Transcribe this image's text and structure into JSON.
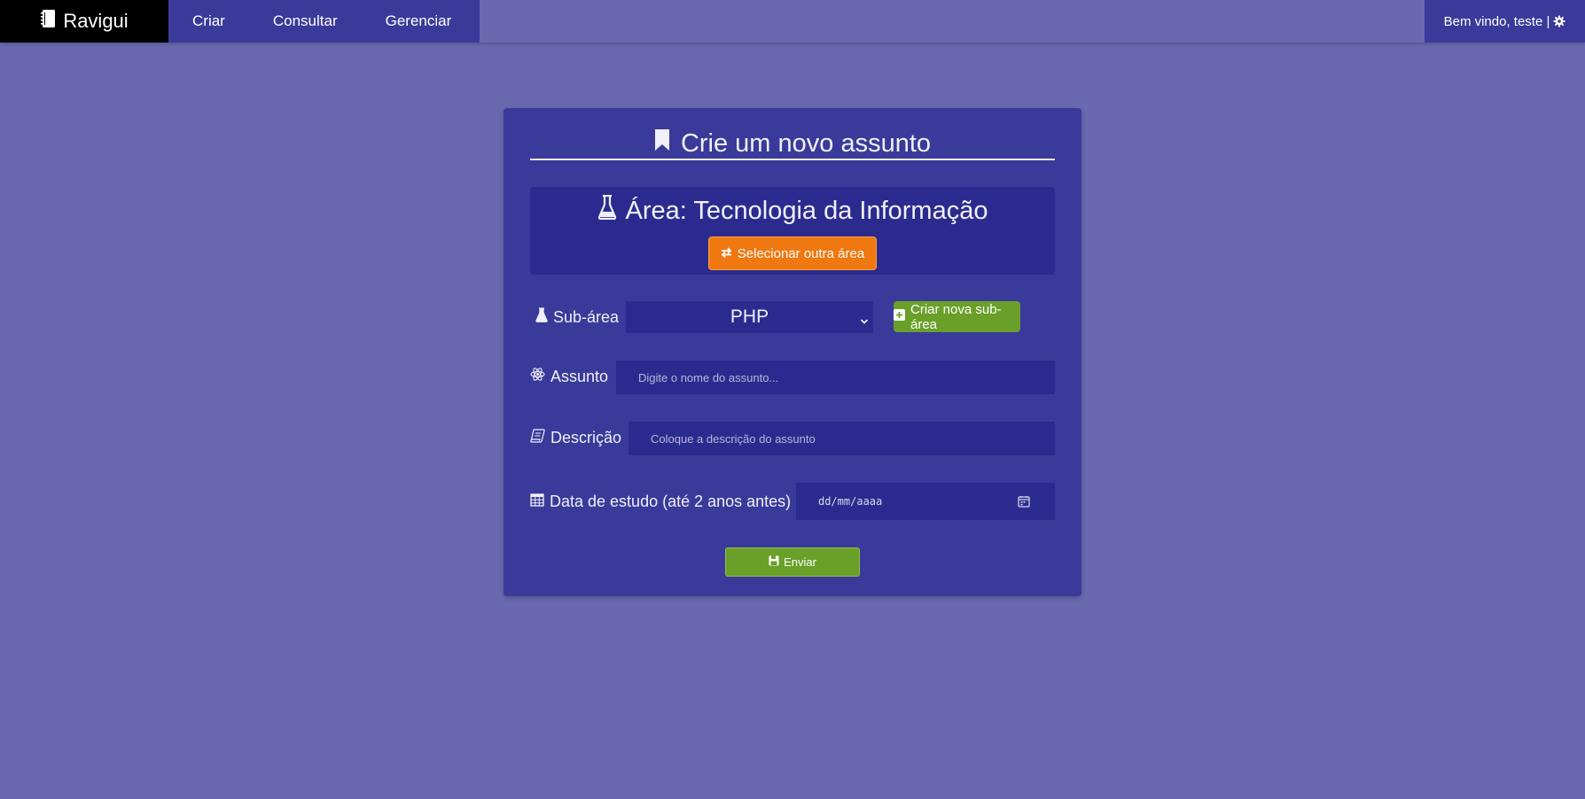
{
  "navbar": {
    "brand": "Ravigui",
    "links": [
      "Criar",
      "Consultar",
      "Gerenciar"
    ],
    "user_text": "Bem vindo, teste |"
  },
  "form": {
    "title": "Crie um novo assunto",
    "area": {
      "label": "Área: Tecnologia da Informação",
      "change_button": "Selecionar outra área"
    },
    "subarea": {
      "label": "Sub-área",
      "selected": "PHP",
      "new_button": "Criar nova sub-área"
    },
    "assunto": {
      "label": "Assunto",
      "placeholder": "Digite o nome do assunto..."
    },
    "descricao": {
      "label": "Descrição",
      "placeholder": "Coloque a descrição do assunto"
    },
    "data": {
      "label": "Data de estudo (até 2 anos antes)",
      "placeholder": "dd/mm/aaaa"
    },
    "submit": "Enviar"
  },
  "colors": {
    "page_bg": "#6a69b0",
    "card_bg": "#3a3a9a",
    "field_bg": "#2b2b8f",
    "orange": "#f07810",
    "green": "#6aa02a"
  },
  "icons": {
    "brand": "notebook-icon",
    "settings": "gear-icon",
    "title": "bookmark-icon",
    "area": "flask-icon",
    "swap": "exchange-icon",
    "subarea": "flask-icon",
    "select": "chevron-down-icon",
    "add": "plus-square-icon",
    "assunto": "atom-icon",
    "descricao": "scroll-icon",
    "data": "calendar-icon",
    "send": "save-icon"
  }
}
